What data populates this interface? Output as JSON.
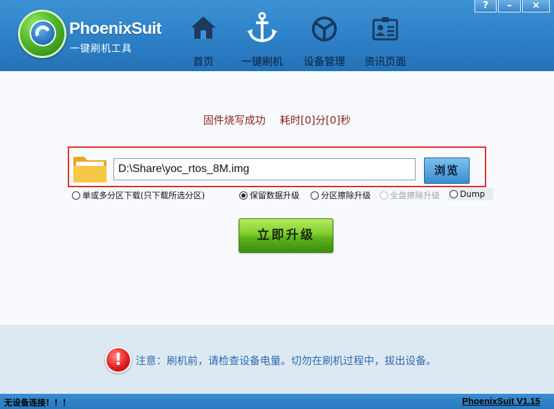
{
  "app": {
    "brand": "PhoenixSuit",
    "subtitle": "一键刷机工具"
  },
  "window_controls": {
    "help": "?",
    "minimize": "–",
    "close": "×"
  },
  "nav": [
    {
      "label": "首页",
      "icon": "home-icon"
    },
    {
      "label": "一键刷机",
      "icon": "anchor-icon"
    },
    {
      "label": "设备管理",
      "icon": "device-icon"
    },
    {
      "label": "资讯页面",
      "icon": "news-icon"
    }
  ],
  "status": {
    "result": "固件烧写成功",
    "elapsed": "耗时[0]分[0]秒"
  },
  "file": {
    "path": "D:\\Share\\yoc_rtos_8M.img",
    "browse_label": "浏览"
  },
  "options": [
    {
      "label": "单或多分区下载(只下载所选分区)",
      "checked": false,
      "disabled": false
    },
    {
      "label": "保留数据升级",
      "checked": true,
      "disabled": false
    },
    {
      "label": "分区擦除升级",
      "checked": false,
      "disabled": false
    },
    {
      "label": "全盘擦除升级",
      "checked": false,
      "disabled": true
    },
    {
      "label": "Dump",
      "checked": false,
      "disabled": false
    }
  ],
  "upgrade_label": "立即升级",
  "notice": "注意：刷机前，请检查设备电量。切勿在刷机过程中，拔出设备。",
  "statusbar": {
    "connection": "无设备连接！！！",
    "version": "PhoenixSuit V1.15"
  },
  "colors": {
    "header": "#2d80c6",
    "status_text": "#8b1f1f",
    "notice_text": "#2d6ab4",
    "highlight_border": "#e02a2a",
    "upgrade_button": "#7fcf2e"
  }
}
